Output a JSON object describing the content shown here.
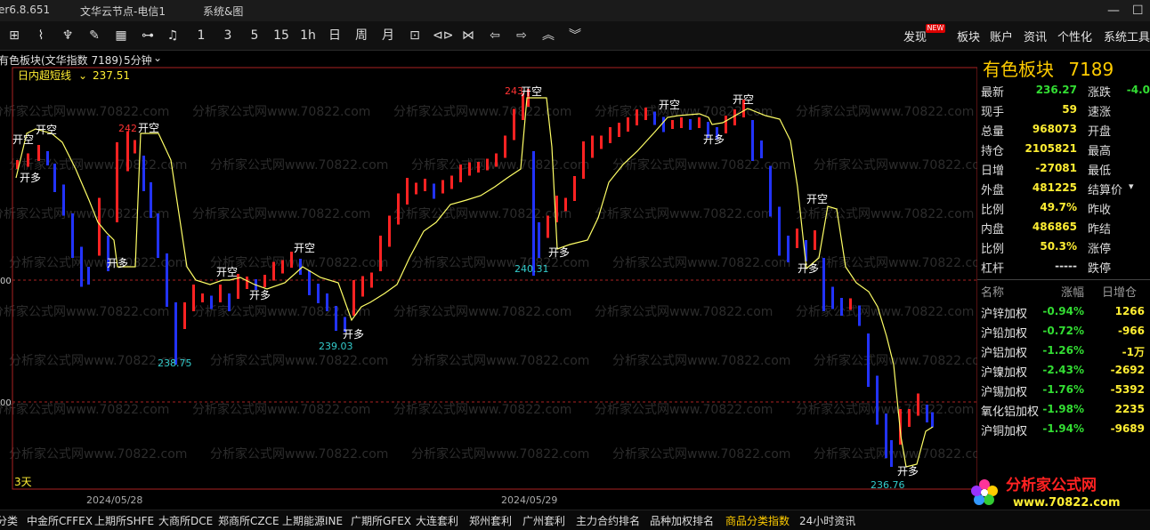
{
  "titlebar": {
    "version": "er6.8.651",
    "server": "文华云节点-电信1",
    "menu": "系统&图"
  },
  "toolbar": {
    "periods": [
      "1",
      "3",
      "5",
      "15",
      "1h",
      "日",
      "周",
      "月"
    ],
    "right_items": [
      "发现",
      "板块",
      "账户",
      "资讯",
      "个性化",
      "系统工具"
    ],
    "new_badge": "NEW"
  },
  "chart_header": {
    "instrument": "有色板块(文华指数 7189)",
    "period": "5分钟",
    "indicator": "日内超短线",
    "indicator_value": "237.51"
  },
  "chart_data": {
    "type": "candlestick",
    "y_tick_labels": [
      "00",
      "00"
    ],
    "x_tick_labels": [
      "2024/05/28",
      "2024/05/29"
    ],
    "footer_label": "3天",
    "signals": [
      "开空",
      "开多"
    ],
    "annotations": [
      {
        "text": "242",
        "color": "#ff3333"
      },
      {
        "text": "238.75",
        "color": "#33cccc"
      },
      {
        "text": "239.03",
        "color": "#33cccc"
      },
      {
        "text": "243",
        "color": "#ff3333"
      },
      {
        "text": "240.31",
        "color": "#33cccc"
      },
      {
        "text": "236.76",
        "color": "#33cccc"
      }
    ],
    "watermark": "分析家公式网www.70822.com",
    "colors": {
      "up": "#ff2222",
      "down": "#2233ff",
      "stop_line": "#ffff66",
      "signal": "#ffffff"
    }
  },
  "panel": {
    "title": "有色板块",
    "code": "7189",
    "quotes": [
      {
        "label": "最新",
        "value": "236.27",
        "color": "#33dd33",
        "label2": "涨跌",
        "value2": "-4.0",
        "color2": "#33dd33"
      },
      {
        "label": "现手",
        "value": "59",
        "color": "#ffee33",
        "label2": "速涨",
        "value2": "",
        "color2": "#dddddd"
      },
      {
        "label": "总量",
        "value": "968073",
        "color": "#ffee33",
        "label2": "开盘",
        "value2": "",
        "color2": "#dddddd"
      },
      {
        "label": "持仓",
        "value": "2105821",
        "color": "#ffee33",
        "label2": "最高",
        "value2": "",
        "color2": "#dddddd"
      },
      {
        "label": "日增",
        "value": "-27081",
        "color": "#ffee33",
        "label2": "最低",
        "value2": "",
        "color2": "#dddddd"
      },
      {
        "label": "外盘",
        "value": "481225",
        "color": "#ffee33",
        "label2": "结算价",
        "value2": "",
        "color2": "#dddddd"
      },
      {
        "label": "比例",
        "value": "49.7%",
        "color": "#ffee33",
        "label2": "昨收",
        "value2": "",
        "color2": "#dddddd"
      },
      {
        "label": "内盘",
        "value": "486865",
        "color": "#ffee33",
        "label2": "昨结",
        "value2": "",
        "color2": "#dddddd"
      },
      {
        "label": "比例",
        "value": "50.3%",
        "color": "#ffee33",
        "label2": "涨停",
        "value2": "",
        "color2": "#dddddd"
      },
      {
        "label": "杠杆",
        "value": "-----",
        "color": "#dddddd",
        "label2": "跌停",
        "value2": "",
        "color2": "#dddddd"
      }
    ],
    "table_headers": [
      "名称",
      "涨幅",
      "日增仓"
    ],
    "products": [
      {
        "name": "沪锌加权",
        "change": "-0.94%",
        "oi": "1266"
      },
      {
        "name": "沪铅加权",
        "change": "-0.72%",
        "oi": "-966"
      },
      {
        "name": "沪铝加权",
        "change": "-1.26%",
        "oi": "-1万"
      },
      {
        "name": "沪镍加权",
        "change": "-2.43%",
        "oi": "-2692"
      },
      {
        "name": "沪锡加权",
        "change": "-1.76%",
        "oi": "-5392"
      },
      {
        "name": "氧化铝加权",
        "change": "-1.98%",
        "oi": "2235"
      },
      {
        "name": "沪铜加权",
        "change": "-1.94%",
        "oi": "-9689"
      }
    ]
  },
  "bottombar": {
    "tabs": [
      "分类",
      "中金所CFFEX",
      "上期所SHFE",
      "大商所DCE",
      "郑商所CZCE",
      "上期能源INE",
      "广期所GFEX",
      "大连套利",
      "郑州套利",
      "广州套利",
      "主力合约排名",
      "品种加权排名",
      "商品分类指数",
      "24小时资讯"
    ],
    "active": "商品分类指数"
  },
  "logo": {
    "text": "分析家公式网",
    "url": "www.70822.com"
  }
}
